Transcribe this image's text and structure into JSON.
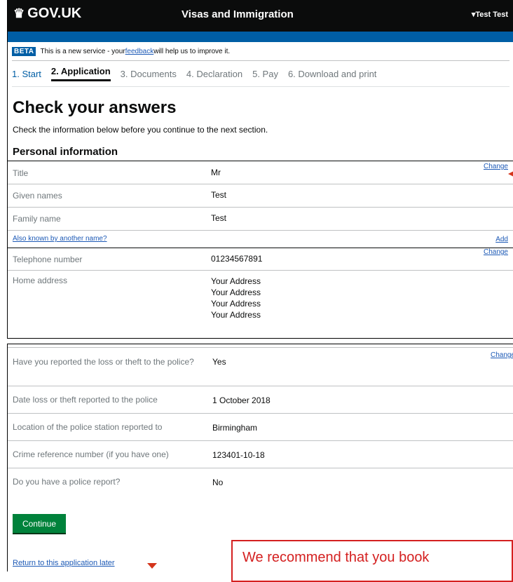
{
  "header": {
    "logo": "GOV.UK",
    "service_name": "Visas and Immigration",
    "user_menu": "▾Test Test"
  },
  "phase_banner": {
    "tag": "BETA",
    "text_before": "This is a new service - your ",
    "link": "feedback",
    "text_after": " will help us to improve it."
  },
  "steps": [
    {
      "label": "1. Start"
    },
    {
      "label": "2. Application"
    },
    {
      "label": "3. Documents"
    },
    {
      "label": "4. Declaration"
    },
    {
      "label": "5. Pay"
    },
    {
      "label": "6. Download and print"
    }
  ],
  "page_title": "Check your answers",
  "intro": "Check the information below before you continue to the next section.",
  "section_title": "Personal information",
  "personal_rows": [
    {
      "key": "Title",
      "value": "Mr",
      "action": "Change"
    },
    {
      "key": "Given names",
      "value": "Test"
    },
    {
      "key": "Family name",
      "value": "Test"
    },
    {
      "link": "Also known by another name?",
      "action": "Add"
    },
    {
      "key": "Telephone number",
      "value": "01234567891",
      "action": "Change"
    },
    {
      "key": "Home address",
      "value_lines": [
        "Your Address",
        "Your Address",
        "Your Address",
        "Your Address"
      ]
    }
  ],
  "police_rows": [
    {
      "key": "Have you reported the loss or theft to the police?",
      "value": "Yes",
      "action": "Change"
    },
    {
      "key": "Date loss or theft reported to the police",
      "value": "1 October 2018"
    },
    {
      "key": "Location of the police station reported to",
      "value": "Birmingham"
    },
    {
      "key": "Crime reference number (if you have one)",
      "value": "123401-10-18"
    },
    {
      "key": "Do you have a police report?",
      "value": "No"
    }
  ],
  "continue_button": "Continue",
  "return_link": "Return to this application later",
  "callout_text": "We recommend that you book",
  "colors": {
    "header_bg": "#0b0c0c",
    "brand_blue": "#005ea5",
    "link": "#1d5ab6",
    "button_green": "#00823b",
    "annotation_red": "#d42020"
  }
}
